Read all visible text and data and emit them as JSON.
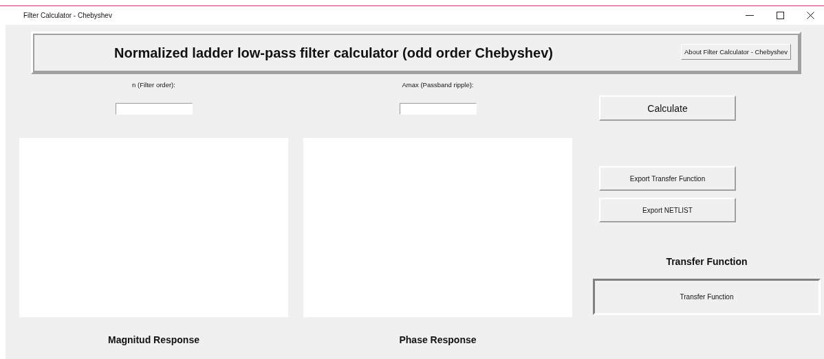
{
  "window": {
    "title": "Filter Calculator - Chebyshev"
  },
  "header": {
    "title": "Normalized ladder low-pass filter calculator (odd order Chebyshev)",
    "about_button": "About Filter Calculator - Chebyshev"
  },
  "panels": [
    {
      "field_label": "n (Filter order):",
      "caption": "Magnitud Response"
    },
    {
      "field_label": "Amax (Passband ripple):",
      "caption": "Phase Response"
    }
  ],
  "calculate_button": "Calculate",
  "export_buttons": [
    "Export Transfer Function",
    "Export NETLIST"
  ],
  "transfer_function": {
    "heading": "Transfer Function",
    "text": "Transfer Function"
  }
}
